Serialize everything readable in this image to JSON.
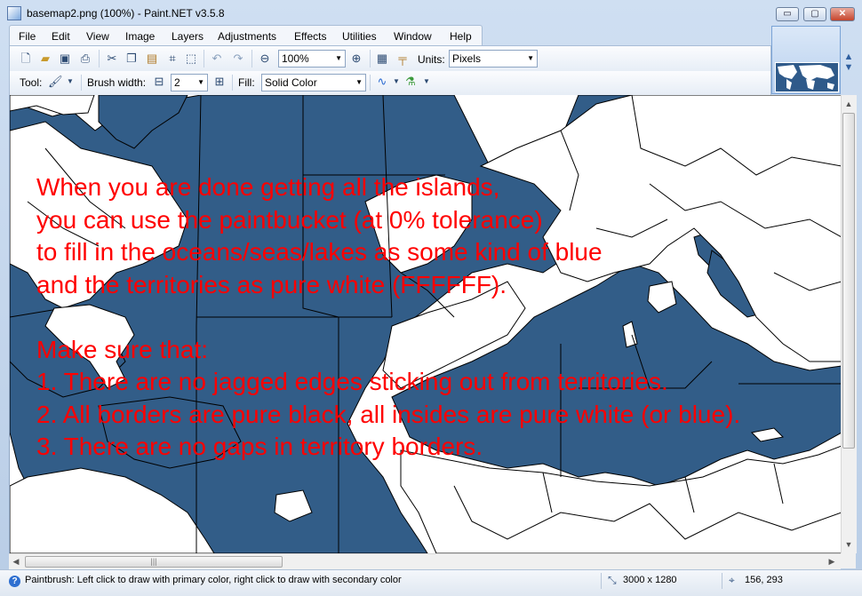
{
  "window": {
    "title": "basemap2.png (100%) - Paint.NET v3.5.8",
    "min_label": "▭",
    "max_label": "▢",
    "close_label": "✕"
  },
  "menu": [
    "File",
    "Edit",
    "View",
    "Image",
    "Layers",
    "Adjustments",
    "Effects",
    "Utilities",
    "Window",
    "Help"
  ],
  "toolbar1": {
    "zoom_value": "100%",
    "units_label": "Units:",
    "units_value": "Pixels"
  },
  "toolbar2": {
    "tool_label": "Tool:",
    "brush_width_label": "Brush width:",
    "brush_width_value": "2",
    "fill_label": "Fill:",
    "fill_value": "Solid Color"
  },
  "canvas": {
    "ocean_color": "#325d88",
    "land_color": "#ffffff",
    "border_color": "#000000",
    "instructions": [
      "When you are done getting all the islands,",
      "you can use the paintbucket (at 0% tolerance)",
      "to fill in the oceans/seas/lakes as some kind of blue",
      "and the territories as pure white (FFFFFF).",
      "",
      "Make sure that:",
      "1. There are no jagged edges sticking out from territories.",
      "2. All borders are pure black, all insides are pure white (or blue).",
      "3. There are no gaps in territory borders."
    ],
    "instruction_color": "#ff0000"
  },
  "status": {
    "message": "Paintbrush: Left click to draw with primary color, right click to draw with secondary color",
    "image_size": "3000 x 1280",
    "cursor_pos": "156, 293"
  }
}
